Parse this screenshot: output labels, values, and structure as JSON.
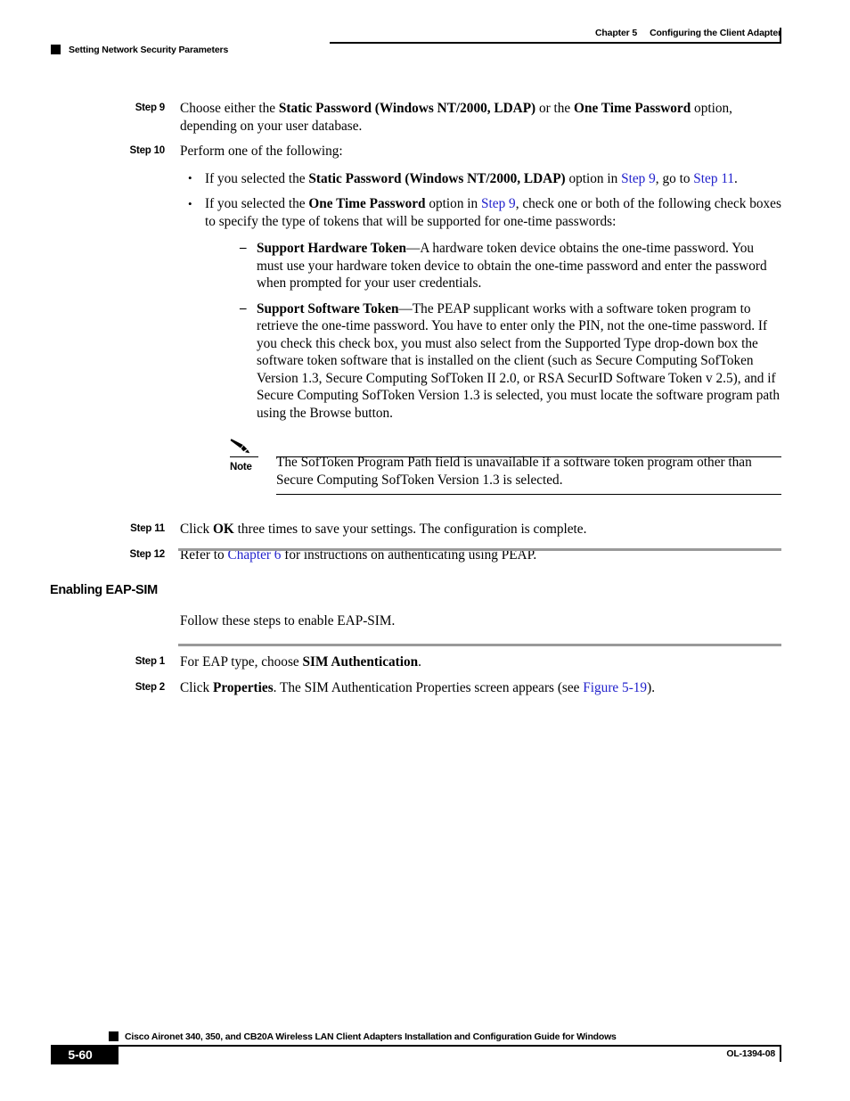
{
  "header": {
    "chapter_number": "Chapter 5",
    "chapter_title": "Configuring the Client Adapter",
    "running_head": "Setting Network Security Parameters"
  },
  "colors": {
    "xref_blue": "#2222cc",
    "rule_gray": "#9a9a9a",
    "ink": "#000000"
  },
  "steps": {
    "step9": {
      "label": "Step 9",
      "t1": "Choose either the ",
      "b1": "Static Password (Windows NT/2000, LDAP)",
      "t2": " or the ",
      "b2": "One Time Password",
      "t3": " option, depending on your user database."
    },
    "step10": {
      "label": "Step 10",
      "text": "Perform one of the following:",
      "bullet1": {
        "t1": "If you selected the ",
        "b1": "Static Password (Windows NT/2000, LDAP)",
        "t2": " option in ",
        "x1": "Step 9",
        "t3": ", go to ",
        "x2": "Step 11",
        "t4": "."
      },
      "bullet2": {
        "t1": "If you selected the ",
        "b1": "One Time Password",
        "t2": " option in ",
        "x1": "Step 9",
        "t3": ", check one or both of the following check boxes to specify the type of tokens that will be supported for one-time passwords:"
      },
      "dash1": {
        "b1": "Support Hardware Token",
        "t1": "—A hardware token device obtains the one-time password. You must use your hardware token device to obtain the one-time password and enter the password when prompted for your user credentials."
      },
      "dash2": {
        "b1": "Support Software Token",
        "t1": "—The PEAP supplicant works with a software token program to retrieve the one-time password. You have to enter only the PIN, not the one-time password. If you check this check box, you must also select from the Supported Type drop-down box the software token software that is installed on the client (such as Secure Computing SofToken Version 1.3, Secure Computing SofToken II 2.0, or RSA SecurID Software Token v 2.5), and if Secure Computing SofToken Version 1.3 is selected, you must locate the software program path using the Browse button."
      }
    },
    "step11": {
      "label": "Step 11",
      "t1": "Click ",
      "b1": "OK",
      "t2": " three times to save your settings. The configuration is complete."
    },
    "step12": {
      "label": "Step 12",
      "t1": "Refer to ",
      "x1": "Chapter 6",
      "t2": " for instructions on authenticating using PEAP."
    }
  },
  "note": {
    "label": "Note",
    "text": "The SofToken Program Path field is unavailable if a software token program other than Secure Computing SofToken Version 1.3 is selected.",
    "icon": "pencil-icon"
  },
  "section": {
    "heading": "Enabling EAP-SIM",
    "intro": "Follow these steps to enable EAP-SIM.",
    "step1": {
      "label": "Step 1",
      "t1": "For EAP type, choose ",
      "b1": "SIM Authentication",
      "t2": "."
    },
    "step2": {
      "label": "Step 2",
      "t1": "Click ",
      "b1": "Properties",
      "t2": ". The SIM Authentication Properties screen appears (see ",
      "x1": "Figure 5-19",
      "t3": ")."
    }
  },
  "footer": {
    "guide_title": "Cisco Aironet 340, 350, and CB20A Wireless LAN Client Adapters Installation and Configuration Guide for Windows",
    "page_number": "5-60",
    "doc_id": "OL-1394-08"
  }
}
